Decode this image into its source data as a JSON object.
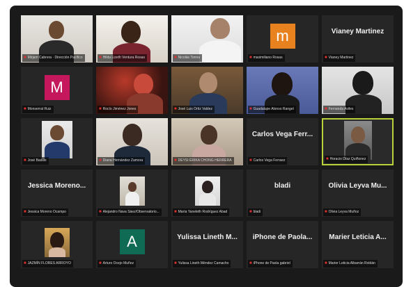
{
  "colors": {
    "frame_bg": "#1a1a1a",
    "tile_bg": "#262626",
    "active_border": "#b9d23a",
    "muted_mic": "#e03030"
  },
  "participants": [
    {
      "label": "Mirjam Cabrera · Dirección Pacífico"
    },
    {
      "label": "Hilda Lizeth Ventura Rosas"
    },
    {
      "label": "Nicolás Torres"
    },
    {
      "label": "maximiliano Rosas",
      "initial": "m",
      "avatar_color": "#e8821e"
    },
    {
      "label": "Vianey Martinez",
      "display_name": "Vianey Martinez"
    },
    {
      "label": "Monserrat Ruiz",
      "initial": "M",
      "avatar_color": "#c5175b"
    },
    {
      "label": "Rocío Jiménez Jones"
    },
    {
      "label": "José Luis Ortiz Valdez"
    },
    {
      "label": "Guadalupe Alonso Rangel"
    },
    {
      "label": "Fernanda Aviles"
    },
    {
      "label": "José Badillo"
    },
    {
      "label": "Diana Hernández Zamora"
    },
    {
      "label": "DEYSI ÉRIKA CHONG HERRERA"
    },
    {
      "label": "Carlos Vega Ferraez",
      "display_name": "Carlos Vega Ferr..."
    },
    {
      "label": "Horacio Díaz Quiñonez"
    },
    {
      "label": "Jessica Moreno Ocampo",
      "display_name": "Jessica Moreno..."
    },
    {
      "label": "Alejandro Nava Sáez/Observatorio..."
    },
    {
      "label": "María Yaneleth Rodríguez Abad"
    },
    {
      "label": "bladi",
      "display_name": "bladi"
    },
    {
      "label": "Olivia Leyva Muñoz",
      "display_name": "Olivia Leyva Mu..."
    },
    {
      "label": "JAZMÍN FLORES ARROYO"
    },
    {
      "label": "Arturo Ocejo Muñoz",
      "initial": "A",
      "avatar_color": "#0f6b54"
    },
    {
      "label": "Yulissa Lineth Méndez Camacho",
      "display_name": "Yulissa Lineth M..."
    },
    {
      "label": "iPhone de Paola gabriel",
      "display_name": "iPhone de Paola..."
    },
    {
      "label": "Marier Leticia Albarrán Roldán",
      "display_name": "Marier Leticia A..."
    }
  ]
}
